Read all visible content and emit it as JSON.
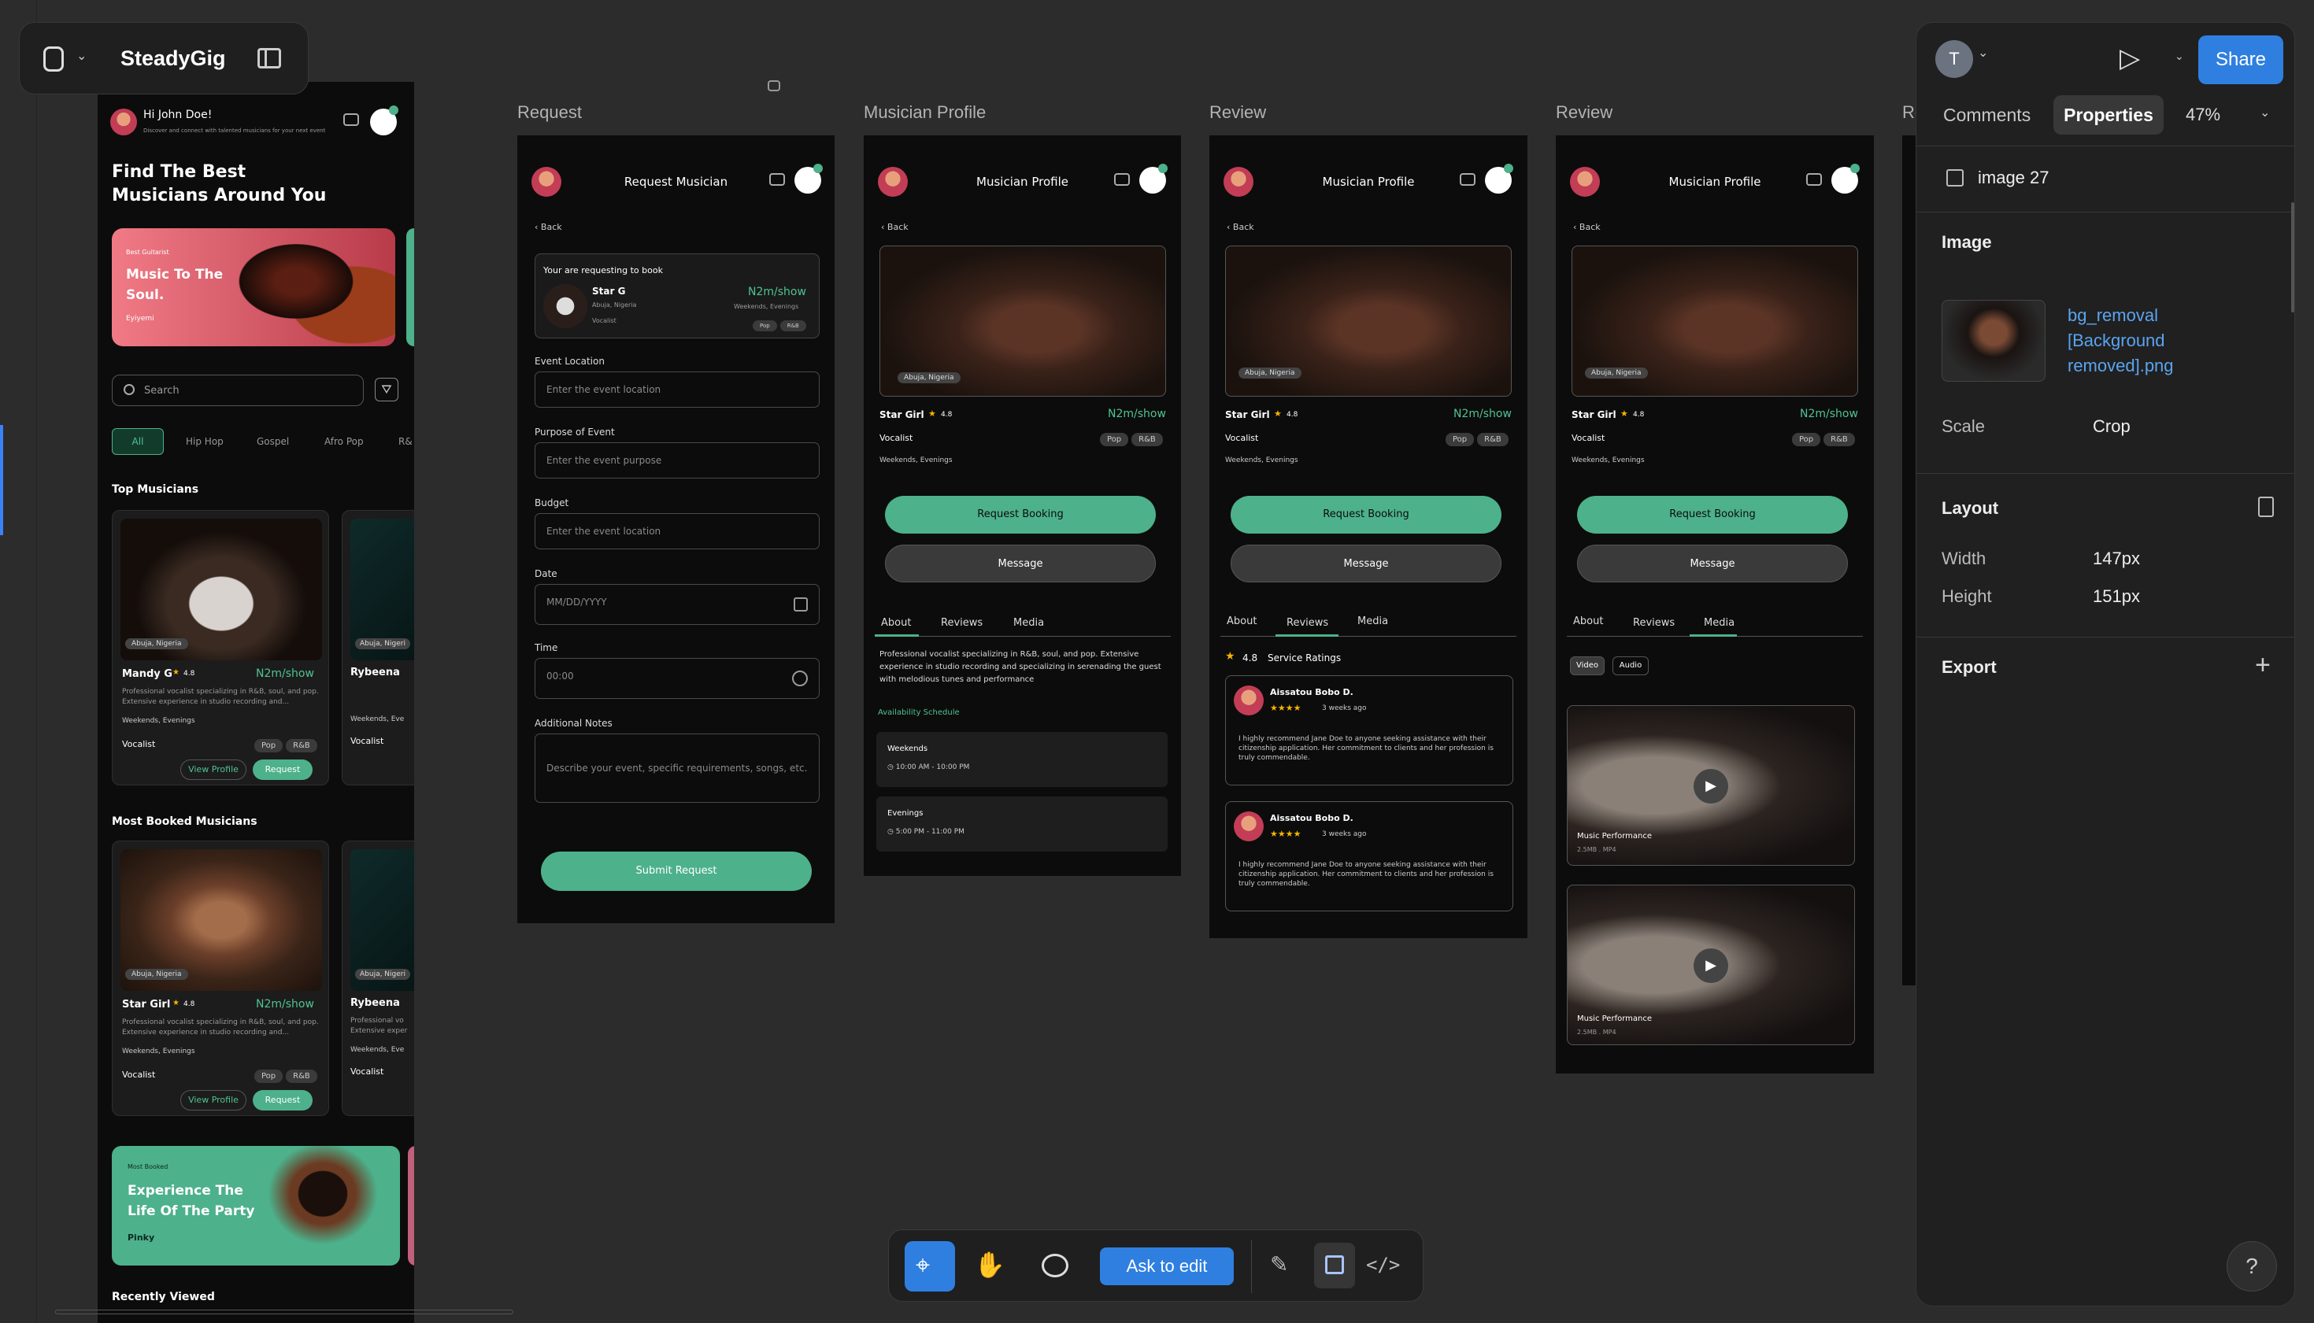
{
  "app": {
    "name": "SteadyGig"
  },
  "frames": {
    "left": {
      "greeting": "Hi John Doe!",
      "greeting_sub": "Discover and connect with talented musicians for your next event",
      "headline": "Find The Best Musicians Around You",
      "hero1_tag": "Best Guitarist",
      "hero1_title": "Music To The Soul.",
      "hero1_name": "Eyiyemi",
      "search_placeholder": "Search",
      "chips": [
        "All",
        "Hip Hop",
        "Gospel",
        "Afro Pop",
        "R&"
      ],
      "top_musicians": "Top Musicians",
      "card1": {
        "location": "Abuja, Nigeria",
        "name": "Mandy G",
        "rating": "4.8",
        "price": "N2m/show",
        "desc": "Professional vocalist specializing in R&B, soul, and pop. Extensive experience in studio recording and...",
        "avail": "Weekends, Evenings",
        "role": "Vocalist",
        "tags": [
          "Pop",
          "R&B"
        ],
        "view": "View Profile",
        "request": "Request"
      },
      "card2": {
        "location": "Abuja, Nigeri",
        "name": "Rybeena",
        "avail": "Weekends, Eve",
        "role": "Vocalist"
      },
      "most_booked": "Most Booked Musicians",
      "card3": {
        "location": "Abuja, Nigeria",
        "name": "Star Girl",
        "rating": "4.8",
        "price": "N2m/show",
        "desc": "Professional vocalist specializing in R&B, soul, and pop. Extensive experience in studio recording and...",
        "avail": "Weekends, Evenings",
        "role": "Vocalist",
        "tags": [
          "Pop",
          "R&B"
        ],
        "view": "View Profile",
        "request": "Request"
      },
      "card4": {
        "location": "Abuja, Nigeri",
        "name": "Rybeena",
        "desc": "Professional vo Extensive exper",
        "avail": "Weekends, Eve",
        "role": "Vocalist"
      },
      "hero2_tag": "Most Booked",
      "hero2_title": "Experience The Life Of The Party",
      "hero2_name": "Pinky",
      "recent": "Recently Viewed"
    },
    "labels": [
      "Request",
      "Musician Profile",
      "Review",
      "Review",
      "Re"
    ],
    "request": {
      "title": "Request Musician",
      "back": "Back",
      "req_label": "Your are requesting to book",
      "name": "Star G",
      "location": "Abuja, Nigeria",
      "role": "Vocalist",
      "price": "N2m/show",
      "avail": "Weekends, Evenings",
      "tags": [
        "Pop",
        "R&B"
      ],
      "f1_label": "Event Location",
      "f1_ph": "Enter the event location",
      "f2_label": "Purpose of Event",
      "f2_ph": "Enter the event purpose",
      "f3_label": "Budget",
      "f3_ph": "Enter the event location",
      "f4_label": "Date",
      "f4_ph": "MM/DD/YYYY",
      "f5_label": "Time",
      "f5_ph": "00:00",
      "f6_label": "Additional Notes",
      "f6_ph": "Describe your event, specific requirements, songs, etc.",
      "submit": "Submit Request"
    },
    "profile": {
      "title": "Musician Profile",
      "back": "Back",
      "location": "Abuja, Nigeria",
      "name": "Star Girl",
      "rating": "4.8",
      "price": "N2m/show",
      "role": "Vocalist",
      "tags": [
        "Pop",
        "R&B"
      ],
      "avail": "Weekends, Evenings",
      "request_booking": "Request Booking",
      "message": "Message",
      "tabs": [
        "About",
        "Reviews",
        "Media"
      ],
      "about_text": "Professional vocalist specializing in R&B, soul, and pop. Extensive experience in studio recording and specializing in serenading the guest with melodious tunes and performance",
      "schedule_title": "Availability Schedule",
      "sched1_title": "Weekends",
      "sched1_time": "10:00 AM - 10:00 PM",
      "sched2_title": "Evenings",
      "sched2_time": "5:00 PM - 11:00 PM"
    },
    "review": {
      "rating": "4.8",
      "ratings_label": "Service Ratings",
      "reviewer": "Aissatou Bobo D.",
      "stars": "★★★★",
      "when": "3 weeks ago",
      "text": "I highly recommend Jane Doe to anyone seeking assistance with their citizenship application. Her commitment to clients and her profession is truly commendable."
    },
    "media": {
      "chips": [
        "Video",
        "Audio"
      ],
      "item_title": "Music Performance",
      "item_meta": "2.5MB . MP4"
    }
  },
  "panel": {
    "user_initial": "T",
    "share": "Share",
    "tabs": [
      "Comments",
      "Properties"
    ],
    "zoom": "47%",
    "layer_name": "image 27",
    "image_heading": "Image",
    "file_name": "bg_removal [Background removed].png",
    "scale_label": "Scale",
    "scale_value": "Crop",
    "layout_heading": "Layout",
    "width_label": "Width",
    "width_value": "147px",
    "height_label": "Height",
    "height_value": "151px",
    "export_heading": "Export"
  },
  "bottom_toolbar": {
    "ask_to_edit": "Ask to edit"
  },
  "colors": {
    "accent": "#4db18b",
    "share_blue": "#2f7fe0",
    "ask_blue": "#2f7fe0"
  }
}
